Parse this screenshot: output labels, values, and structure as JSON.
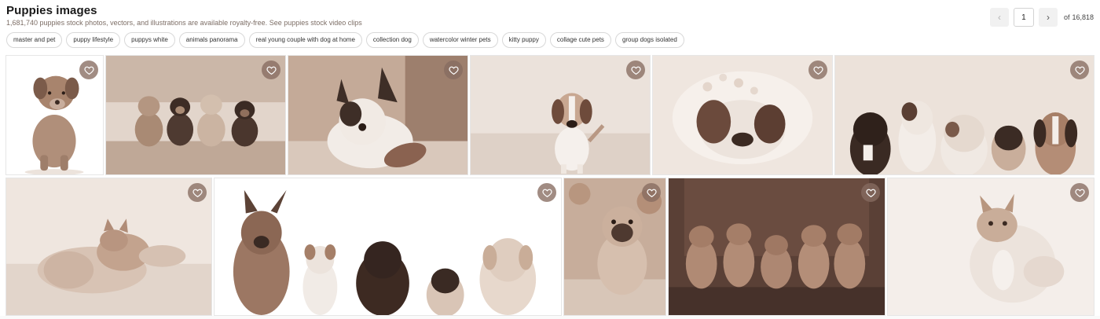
{
  "header": {
    "title": "Puppies images",
    "subtitle": "1,681,740 puppies stock photos, vectors, and illustrations are available royalty-free. See puppies stock video clips"
  },
  "tags": [
    "master and pet",
    "puppy lifestyle",
    "puppys white",
    "animals panorama",
    "real young couple with dog at home",
    "collection dog",
    "watercolor winter pets",
    "kitty puppy",
    "collage cute pets",
    "group dogs isolated"
  ],
  "pagination": {
    "current_page": "1",
    "of_label": "of",
    "total_pages": "16,818",
    "prev_icon": "chevron-left-icon",
    "next_icon": "chevron-right-icon"
  },
  "images": [
    {
      "id": "puppy-sitting",
      "favorite_icon": "heart-icon"
    },
    {
      "id": "four-puppies-on-sofa",
      "favorite_icon": "heart-icon"
    },
    {
      "id": "bulldog-with-toy",
      "favorite_icon": "heart-icon"
    },
    {
      "id": "beagle-puppy-standing",
      "favorite_icon": "heart-icon"
    },
    {
      "id": "puppy-sleeping-in-blanket",
      "favorite_icon": "heart-icon"
    },
    {
      "id": "group-of-dogs-row",
      "favorite_icon": "heart-icon"
    },
    {
      "id": "kitten-and-puppy-sleeping",
      "favorite_icon": "heart-icon"
    },
    {
      "id": "five-dogs-isolated",
      "favorite_icon": "heart-icon"
    },
    {
      "id": "pug-puppy-on-rug",
      "favorite_icon": "heart-icon"
    },
    {
      "id": "five-shiba-puppies",
      "favorite_icon": "heart-icon"
    },
    {
      "id": "kitten-paw-raised",
      "favorite_icon": "heart-icon"
    }
  ],
  "colors": {
    "accent_heart_bg": "#866c60",
    "chip_border": "#d8d8d8",
    "photo_tone": "#c8b2a2"
  }
}
